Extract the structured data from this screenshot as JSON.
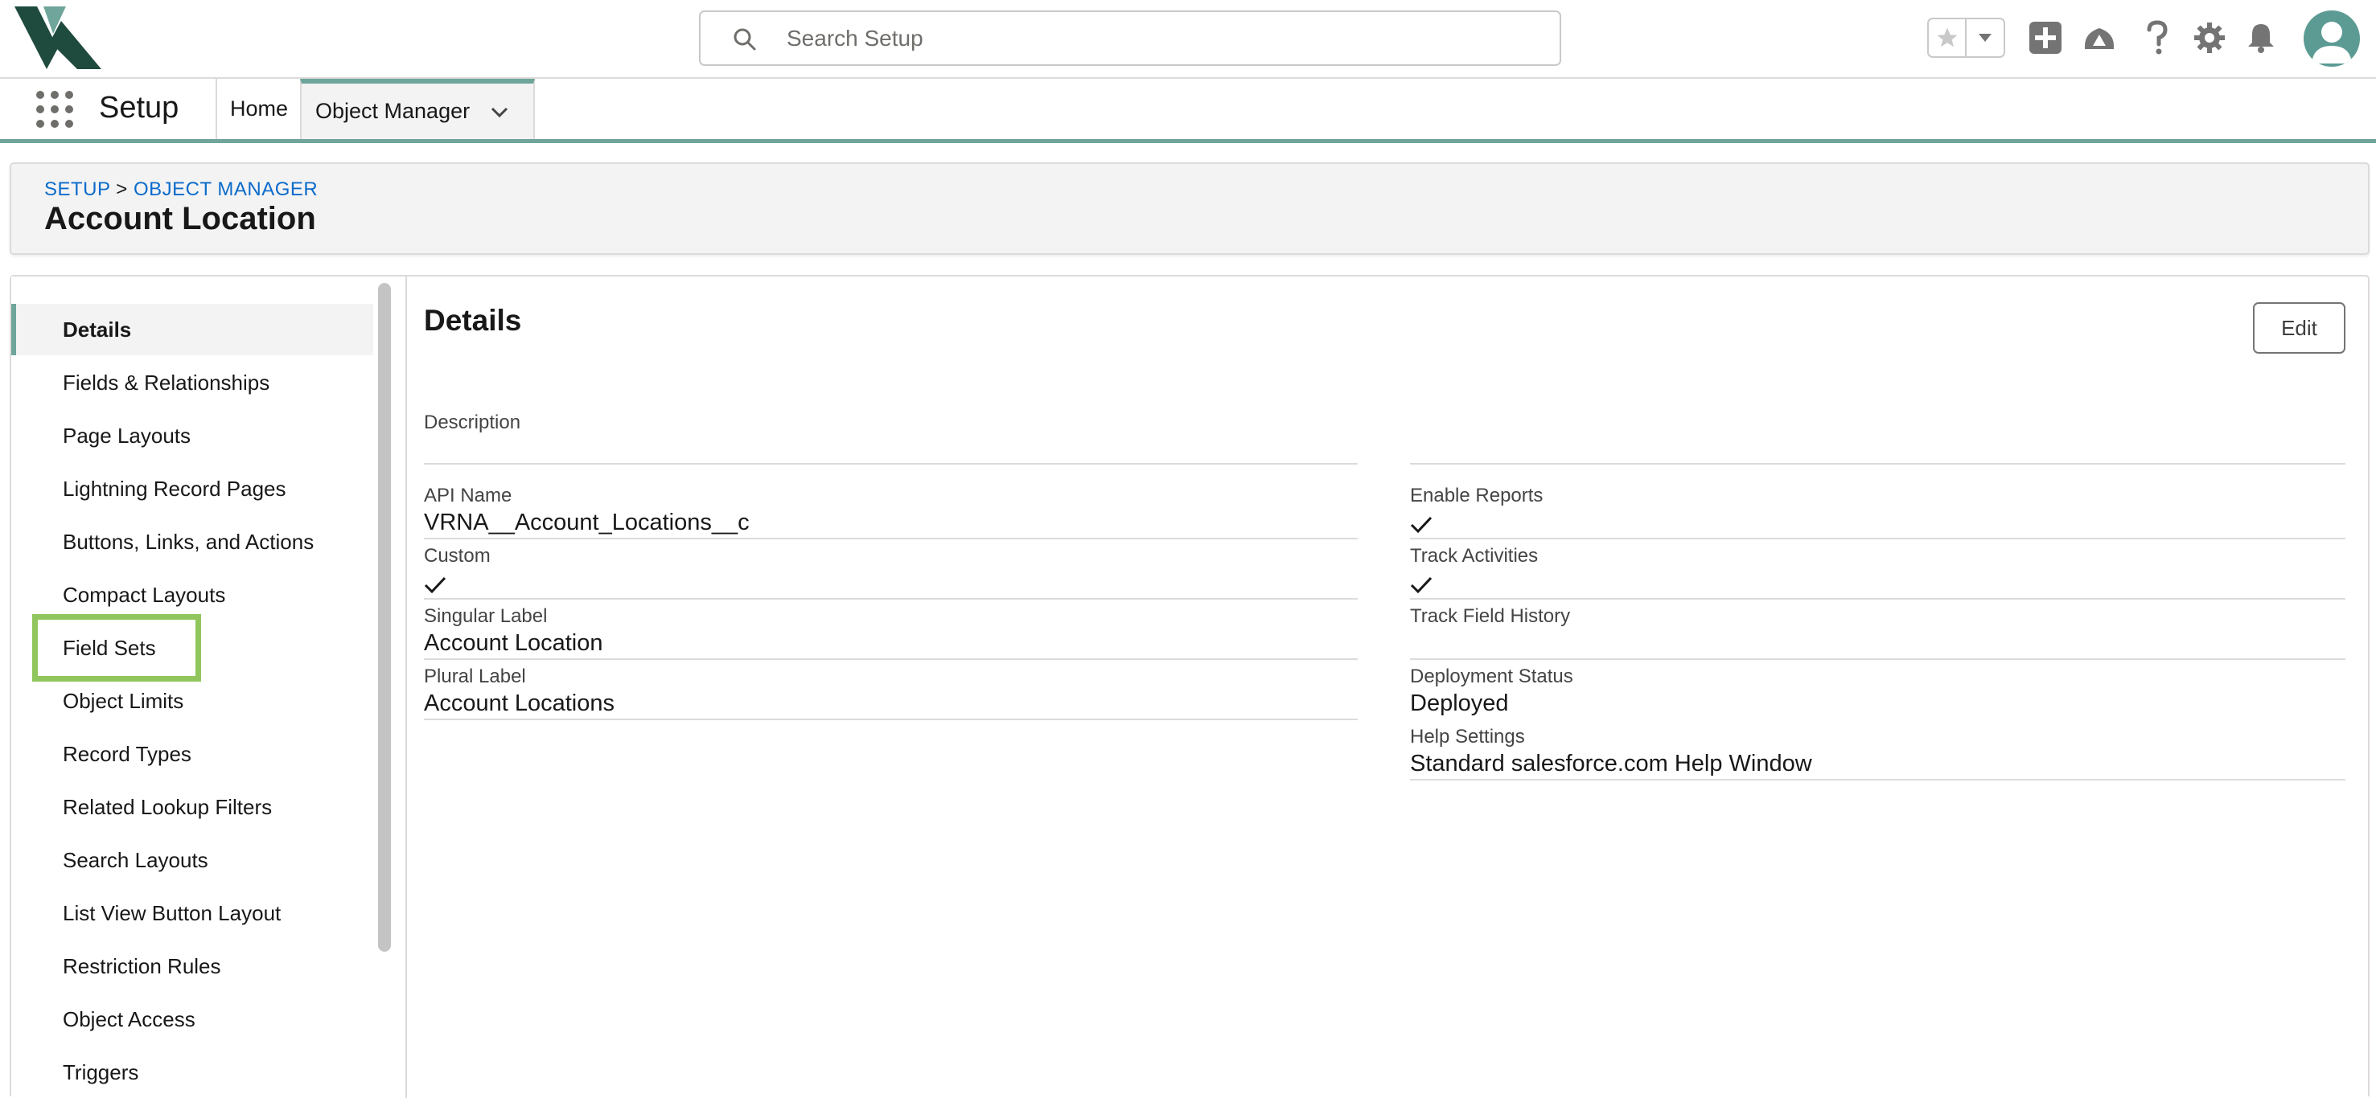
{
  "search": {
    "placeholder": "Search Setup"
  },
  "header_icons": [
    "favorites-star-icon",
    "favorites-dropdown-icon",
    "global-actions-icon",
    "trailhead-icon",
    "help-icon",
    "setup-gear-icon",
    "notifications-bell-icon",
    "user-avatar"
  ],
  "nav": {
    "app_name": "Setup",
    "tabs": [
      {
        "label": "Home"
      },
      {
        "label": "Object Manager"
      }
    ]
  },
  "breadcrumb": {
    "setup": "SETUP",
    "separator": ">",
    "object_manager": "OBJECT MANAGER"
  },
  "page": {
    "title": "Account Location"
  },
  "sidebar": {
    "items": [
      {
        "label": "Details"
      },
      {
        "label": "Fields & Relationships"
      },
      {
        "label": "Page Layouts"
      },
      {
        "label": "Lightning Record Pages"
      },
      {
        "label": "Buttons, Links, and Actions"
      },
      {
        "label": "Compact Layouts"
      },
      {
        "label": "Field Sets"
      },
      {
        "label": "Object Limits"
      },
      {
        "label": "Record Types"
      },
      {
        "label": "Related Lookup Filters"
      },
      {
        "label": "Search Layouts"
      },
      {
        "label": "List View Button Layout"
      },
      {
        "label": "Restriction Rules"
      },
      {
        "label": "Object Access"
      },
      {
        "label": "Triggers"
      }
    ]
  },
  "details": {
    "title": "Details",
    "edit_label": "Edit",
    "description_label": "Description",
    "left": [
      {
        "label": "API Name",
        "value": "VRNA__Account_Locations__c"
      },
      {
        "label": "Custom",
        "checked": true
      },
      {
        "label": "Singular Label",
        "value": "Account Location"
      },
      {
        "label": "Plural Label",
        "value": "Account Locations"
      }
    ],
    "right": [
      {
        "label": "Enable Reports",
        "checked": true
      },
      {
        "label": "Track Activities",
        "checked": true
      },
      {
        "label": "Track Field History",
        "value": ""
      },
      {
        "label": "Deployment Status",
        "value": "Deployed"
      },
      {
        "label": "Help Settings",
        "value": "Standard salesforce.com Help Window"
      }
    ]
  },
  "colors": {
    "accent": "#6fa59a",
    "highlight": "#90c65d",
    "link": "#0b6bcb",
    "brand_logo": "#1f4b3f"
  }
}
